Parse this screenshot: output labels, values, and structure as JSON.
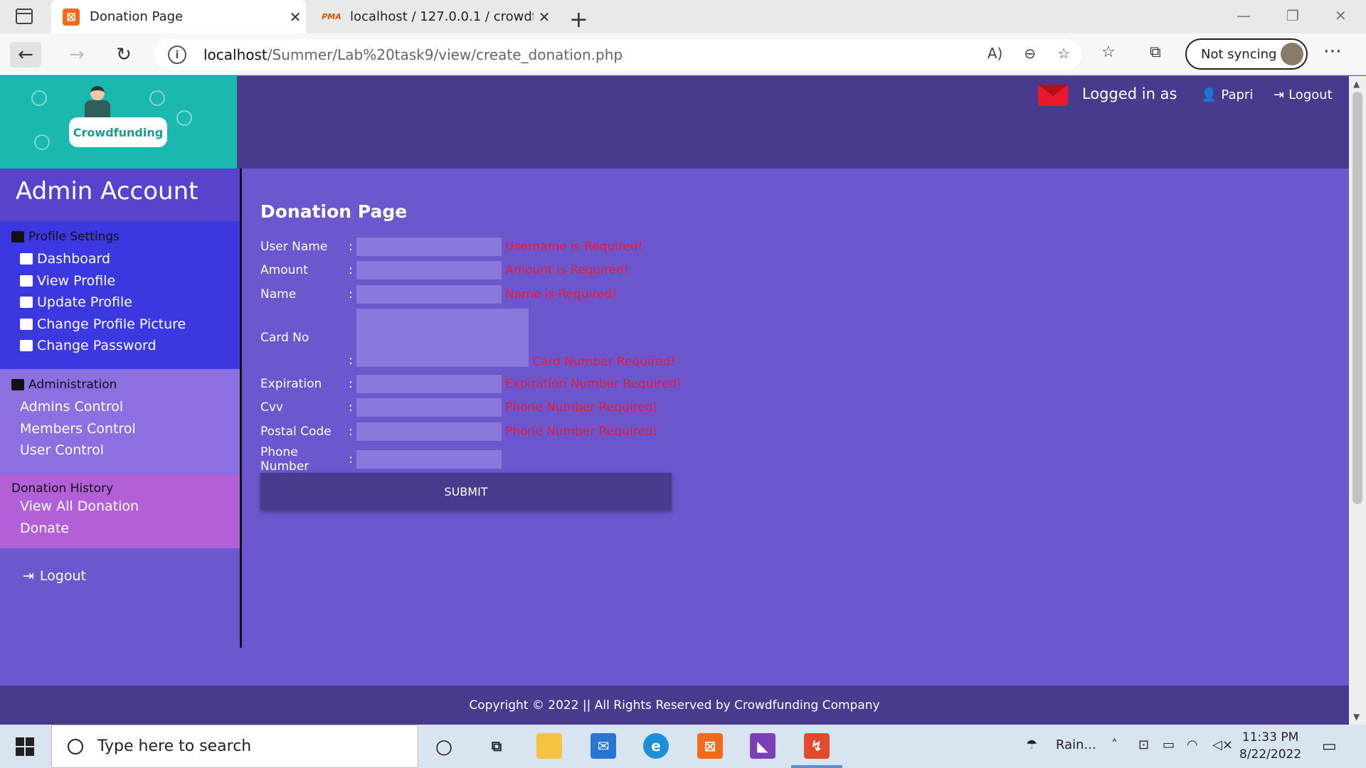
{
  "browser": {
    "tabs": [
      {
        "title": "Donation Page",
        "icon": "xampp-icon",
        "active": true
      },
      {
        "title": "localhost / 127.0.0.1 / crowdfund",
        "icon": "phpmyadmin-icon",
        "active": false
      }
    ],
    "url_host": "localhost",
    "url_path": "/Summer/Lab%20task9/view/create_donation.php",
    "sync_label": "Not syncing"
  },
  "header": {
    "logo_text": "Crowdfunding",
    "logged_in_label": "Logged in as",
    "user_name": "Papri",
    "logout_label": "Logout"
  },
  "sidebar": {
    "title": "Admin Account",
    "profile_section": {
      "heading": "Profile Settings",
      "items": [
        "Dashboard",
        "View Profile",
        "Update Profile",
        "Change Profile Picture",
        "Change Password"
      ]
    },
    "admin_section": {
      "heading": "Administration",
      "items": [
        "Admins Control",
        "Members Control",
        "User Control"
      ]
    },
    "donation_section": {
      "heading": "Donation History",
      "items": [
        "View All Donation",
        "Donate"
      ]
    },
    "logout_label": "Logout"
  },
  "form": {
    "title": "Donation Page",
    "fields": [
      {
        "label": "User Name",
        "error": "Username is Required!"
      },
      {
        "label": "Amount",
        "error": "Amount is Required!"
      },
      {
        "label": "Name",
        "error": "Name is Required!"
      },
      {
        "label": "Card No",
        "error": "Card Number Required!"
      },
      {
        "label": "Expiration",
        "error": "Expiration Number Required!"
      },
      {
        "label": "Cvv",
        "error": "Phone Number Required!"
      },
      {
        "label": "Postal Code",
        "error": "Phone Number Required!"
      },
      {
        "label": "Phone Number",
        "error": ""
      }
    ],
    "colon": ":",
    "submit_label": "SUBMIT"
  },
  "footer": {
    "text": "Copyright © 2022 || All Rights Reserved by Crowdfunding Company"
  },
  "taskbar": {
    "search_placeholder": "Type here to search",
    "weather": "Rain...",
    "time": "11:33 PM",
    "date": "8/22/2022"
  },
  "colors": {
    "page_bg": "#6c57cf",
    "topbar": "#483b8e",
    "logo_bg": "#1bb8b0",
    "error": "#e81a3a"
  }
}
